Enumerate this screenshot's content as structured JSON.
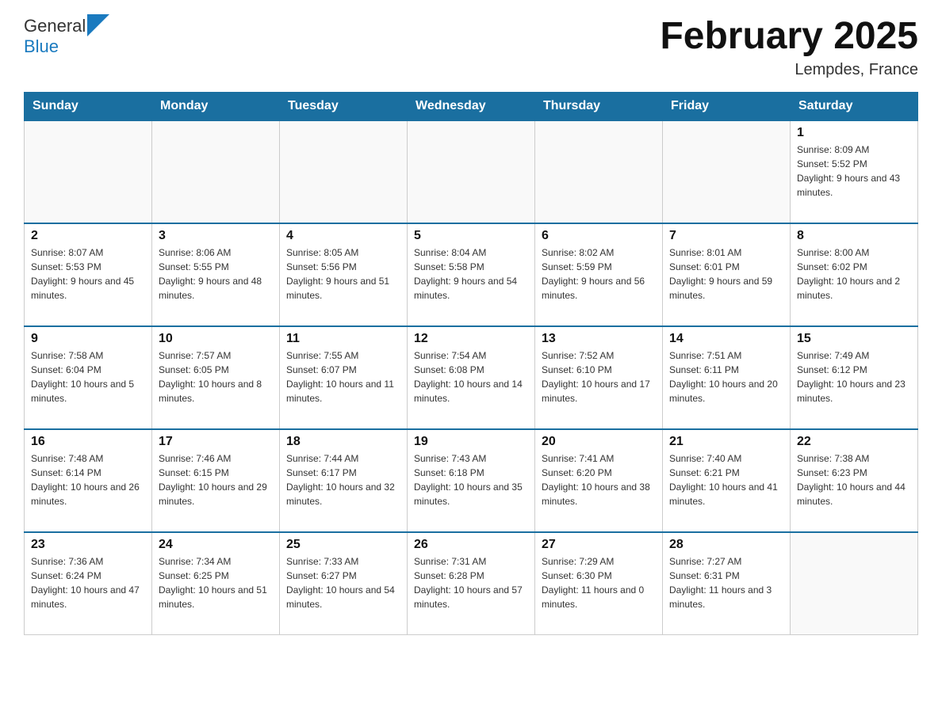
{
  "header": {
    "logo_general": "General",
    "logo_blue": "Blue",
    "title": "February 2025",
    "subtitle": "Lempdes, France"
  },
  "weekdays": [
    "Sunday",
    "Monday",
    "Tuesday",
    "Wednesday",
    "Thursday",
    "Friday",
    "Saturday"
  ],
  "weeks": [
    [
      {
        "day": "",
        "info": ""
      },
      {
        "day": "",
        "info": ""
      },
      {
        "day": "",
        "info": ""
      },
      {
        "day": "",
        "info": ""
      },
      {
        "day": "",
        "info": ""
      },
      {
        "day": "",
        "info": ""
      },
      {
        "day": "1",
        "info": "Sunrise: 8:09 AM\nSunset: 5:52 PM\nDaylight: 9 hours and 43 minutes."
      }
    ],
    [
      {
        "day": "2",
        "info": "Sunrise: 8:07 AM\nSunset: 5:53 PM\nDaylight: 9 hours and 45 minutes."
      },
      {
        "day": "3",
        "info": "Sunrise: 8:06 AM\nSunset: 5:55 PM\nDaylight: 9 hours and 48 minutes."
      },
      {
        "day": "4",
        "info": "Sunrise: 8:05 AM\nSunset: 5:56 PM\nDaylight: 9 hours and 51 minutes."
      },
      {
        "day": "5",
        "info": "Sunrise: 8:04 AM\nSunset: 5:58 PM\nDaylight: 9 hours and 54 minutes."
      },
      {
        "day": "6",
        "info": "Sunrise: 8:02 AM\nSunset: 5:59 PM\nDaylight: 9 hours and 56 minutes."
      },
      {
        "day": "7",
        "info": "Sunrise: 8:01 AM\nSunset: 6:01 PM\nDaylight: 9 hours and 59 minutes."
      },
      {
        "day": "8",
        "info": "Sunrise: 8:00 AM\nSunset: 6:02 PM\nDaylight: 10 hours and 2 minutes."
      }
    ],
    [
      {
        "day": "9",
        "info": "Sunrise: 7:58 AM\nSunset: 6:04 PM\nDaylight: 10 hours and 5 minutes."
      },
      {
        "day": "10",
        "info": "Sunrise: 7:57 AM\nSunset: 6:05 PM\nDaylight: 10 hours and 8 minutes."
      },
      {
        "day": "11",
        "info": "Sunrise: 7:55 AM\nSunset: 6:07 PM\nDaylight: 10 hours and 11 minutes."
      },
      {
        "day": "12",
        "info": "Sunrise: 7:54 AM\nSunset: 6:08 PM\nDaylight: 10 hours and 14 minutes."
      },
      {
        "day": "13",
        "info": "Sunrise: 7:52 AM\nSunset: 6:10 PM\nDaylight: 10 hours and 17 minutes."
      },
      {
        "day": "14",
        "info": "Sunrise: 7:51 AM\nSunset: 6:11 PM\nDaylight: 10 hours and 20 minutes."
      },
      {
        "day": "15",
        "info": "Sunrise: 7:49 AM\nSunset: 6:12 PM\nDaylight: 10 hours and 23 minutes."
      }
    ],
    [
      {
        "day": "16",
        "info": "Sunrise: 7:48 AM\nSunset: 6:14 PM\nDaylight: 10 hours and 26 minutes."
      },
      {
        "day": "17",
        "info": "Sunrise: 7:46 AM\nSunset: 6:15 PM\nDaylight: 10 hours and 29 minutes."
      },
      {
        "day": "18",
        "info": "Sunrise: 7:44 AM\nSunset: 6:17 PM\nDaylight: 10 hours and 32 minutes."
      },
      {
        "day": "19",
        "info": "Sunrise: 7:43 AM\nSunset: 6:18 PM\nDaylight: 10 hours and 35 minutes."
      },
      {
        "day": "20",
        "info": "Sunrise: 7:41 AM\nSunset: 6:20 PM\nDaylight: 10 hours and 38 minutes."
      },
      {
        "day": "21",
        "info": "Sunrise: 7:40 AM\nSunset: 6:21 PM\nDaylight: 10 hours and 41 minutes."
      },
      {
        "day": "22",
        "info": "Sunrise: 7:38 AM\nSunset: 6:23 PM\nDaylight: 10 hours and 44 minutes."
      }
    ],
    [
      {
        "day": "23",
        "info": "Sunrise: 7:36 AM\nSunset: 6:24 PM\nDaylight: 10 hours and 47 minutes."
      },
      {
        "day": "24",
        "info": "Sunrise: 7:34 AM\nSunset: 6:25 PM\nDaylight: 10 hours and 51 minutes."
      },
      {
        "day": "25",
        "info": "Sunrise: 7:33 AM\nSunset: 6:27 PM\nDaylight: 10 hours and 54 minutes."
      },
      {
        "day": "26",
        "info": "Sunrise: 7:31 AM\nSunset: 6:28 PM\nDaylight: 10 hours and 57 minutes."
      },
      {
        "day": "27",
        "info": "Sunrise: 7:29 AM\nSunset: 6:30 PM\nDaylight: 11 hours and 0 minutes."
      },
      {
        "day": "28",
        "info": "Sunrise: 7:27 AM\nSunset: 6:31 PM\nDaylight: 11 hours and 3 minutes."
      },
      {
        "day": "",
        "info": ""
      }
    ]
  ]
}
